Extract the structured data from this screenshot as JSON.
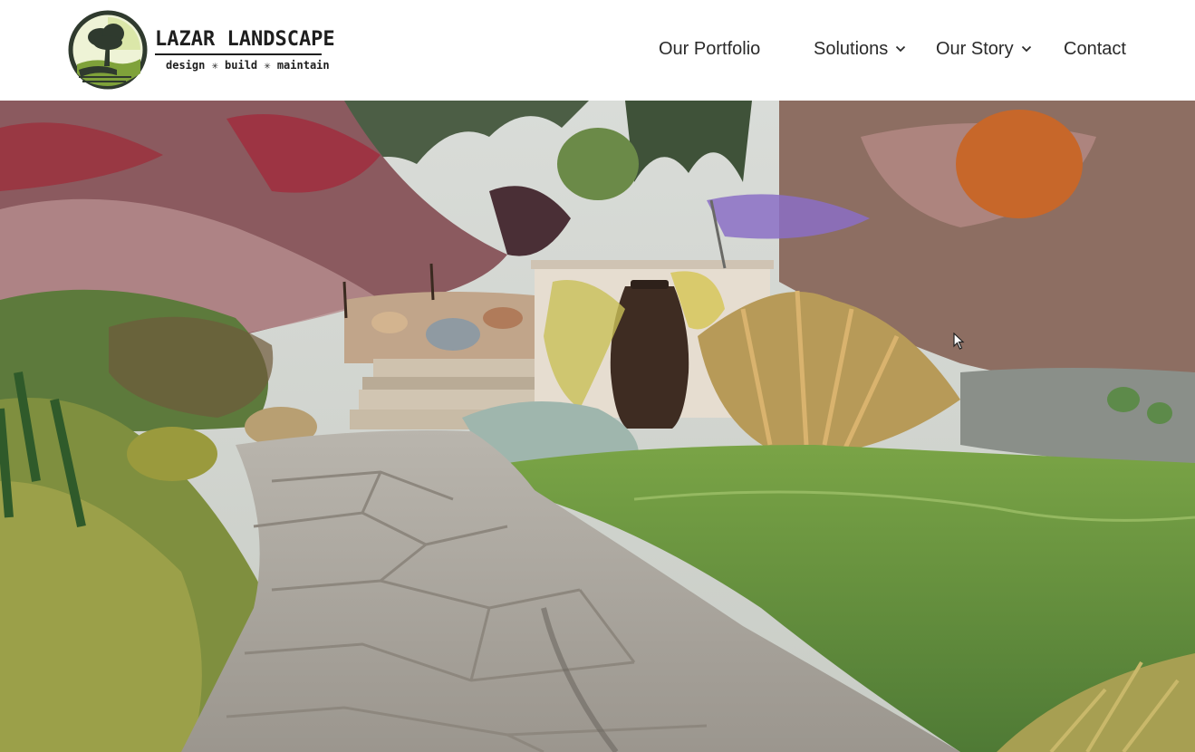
{
  "brand": {
    "name": "LAZAR LANDSCAPE",
    "tagline": "design ✳ build ✳ maintain",
    "colors": {
      "ring": "#2f3a2e",
      "leaf": "#7fa23a",
      "sun": "#cfe08a"
    }
  },
  "nav": {
    "items": [
      {
        "label": "Our Portfolio",
        "has_dropdown": false
      },
      {
        "label": "Solutions",
        "has_dropdown": true
      },
      {
        "label": "Our Story",
        "has_dropdown": true
      },
      {
        "label": "Contact",
        "has_dropdown": false
      }
    ]
  },
  "hero": {
    "icon": "landscape-garden-photo",
    "colors": {
      "sky": "#d7dad6",
      "path": "#a9a49c",
      "grass": "#6f9a3d",
      "wall": "#e6ddd0",
      "urn": "#3e2c22"
    }
  },
  "pointer": {
    "icon": "mouse-cursor-icon"
  }
}
